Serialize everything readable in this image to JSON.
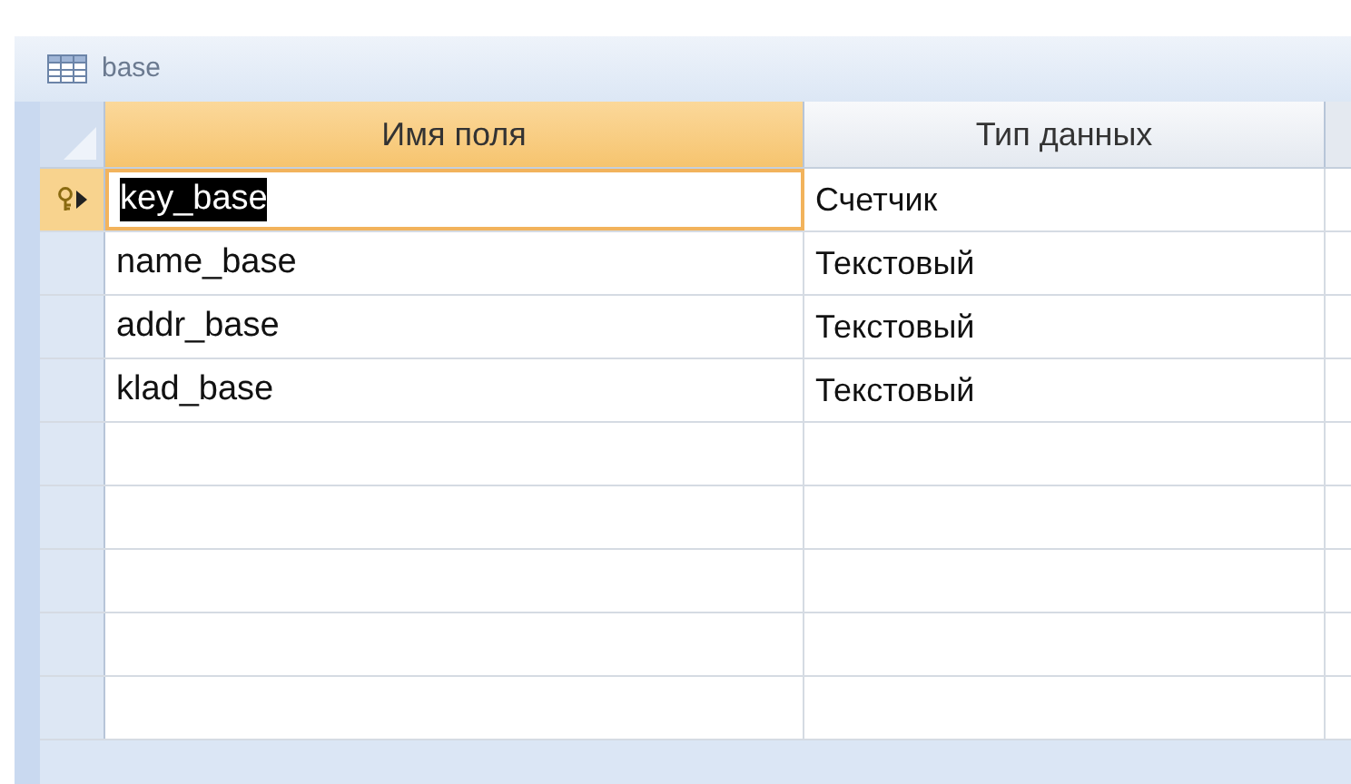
{
  "tab": {
    "title": "base"
  },
  "table": {
    "columns": [
      "Имя поля",
      "Тип данных"
    ],
    "rows": [
      {
        "name": "key_base",
        "type": "Счетчик",
        "primary_key": true,
        "selected": true
      },
      {
        "name": "name_base",
        "type": "Текстовый",
        "primary_key": false,
        "selected": false
      },
      {
        "name": "addr_base",
        "type": "Текстовый",
        "primary_key": false,
        "selected": false
      },
      {
        "name": "klad_base",
        "type": "Текстовый",
        "primary_key": false,
        "selected": false
      }
    ]
  }
}
